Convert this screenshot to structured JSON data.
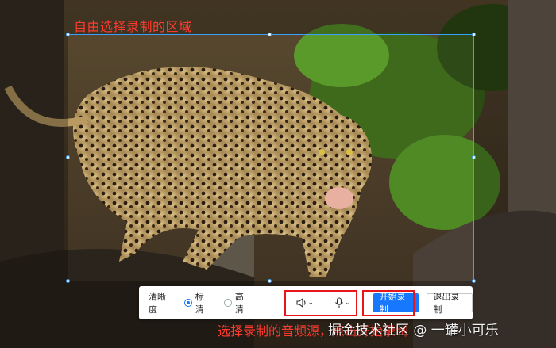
{
  "hints": {
    "top": "自由选择录制的区域",
    "bottom": "选择录制的音频源，点击开始录制"
  },
  "toolbar": {
    "clarity_label": "清晰度",
    "option_standard": "标清",
    "option_high": "高清",
    "selected_quality": "标清",
    "speaker_icon": "speaker-icon",
    "mic_icon": "microphone-icon",
    "start_label": "开始录制",
    "exit_label": "退出录制"
  },
  "watermark": "掘金技术社区 @ 一罐小可乐",
  "colors": {
    "accent": "#1677ff",
    "hint_red": "#ff3b2f",
    "selection_border": "#3aa0ff"
  }
}
